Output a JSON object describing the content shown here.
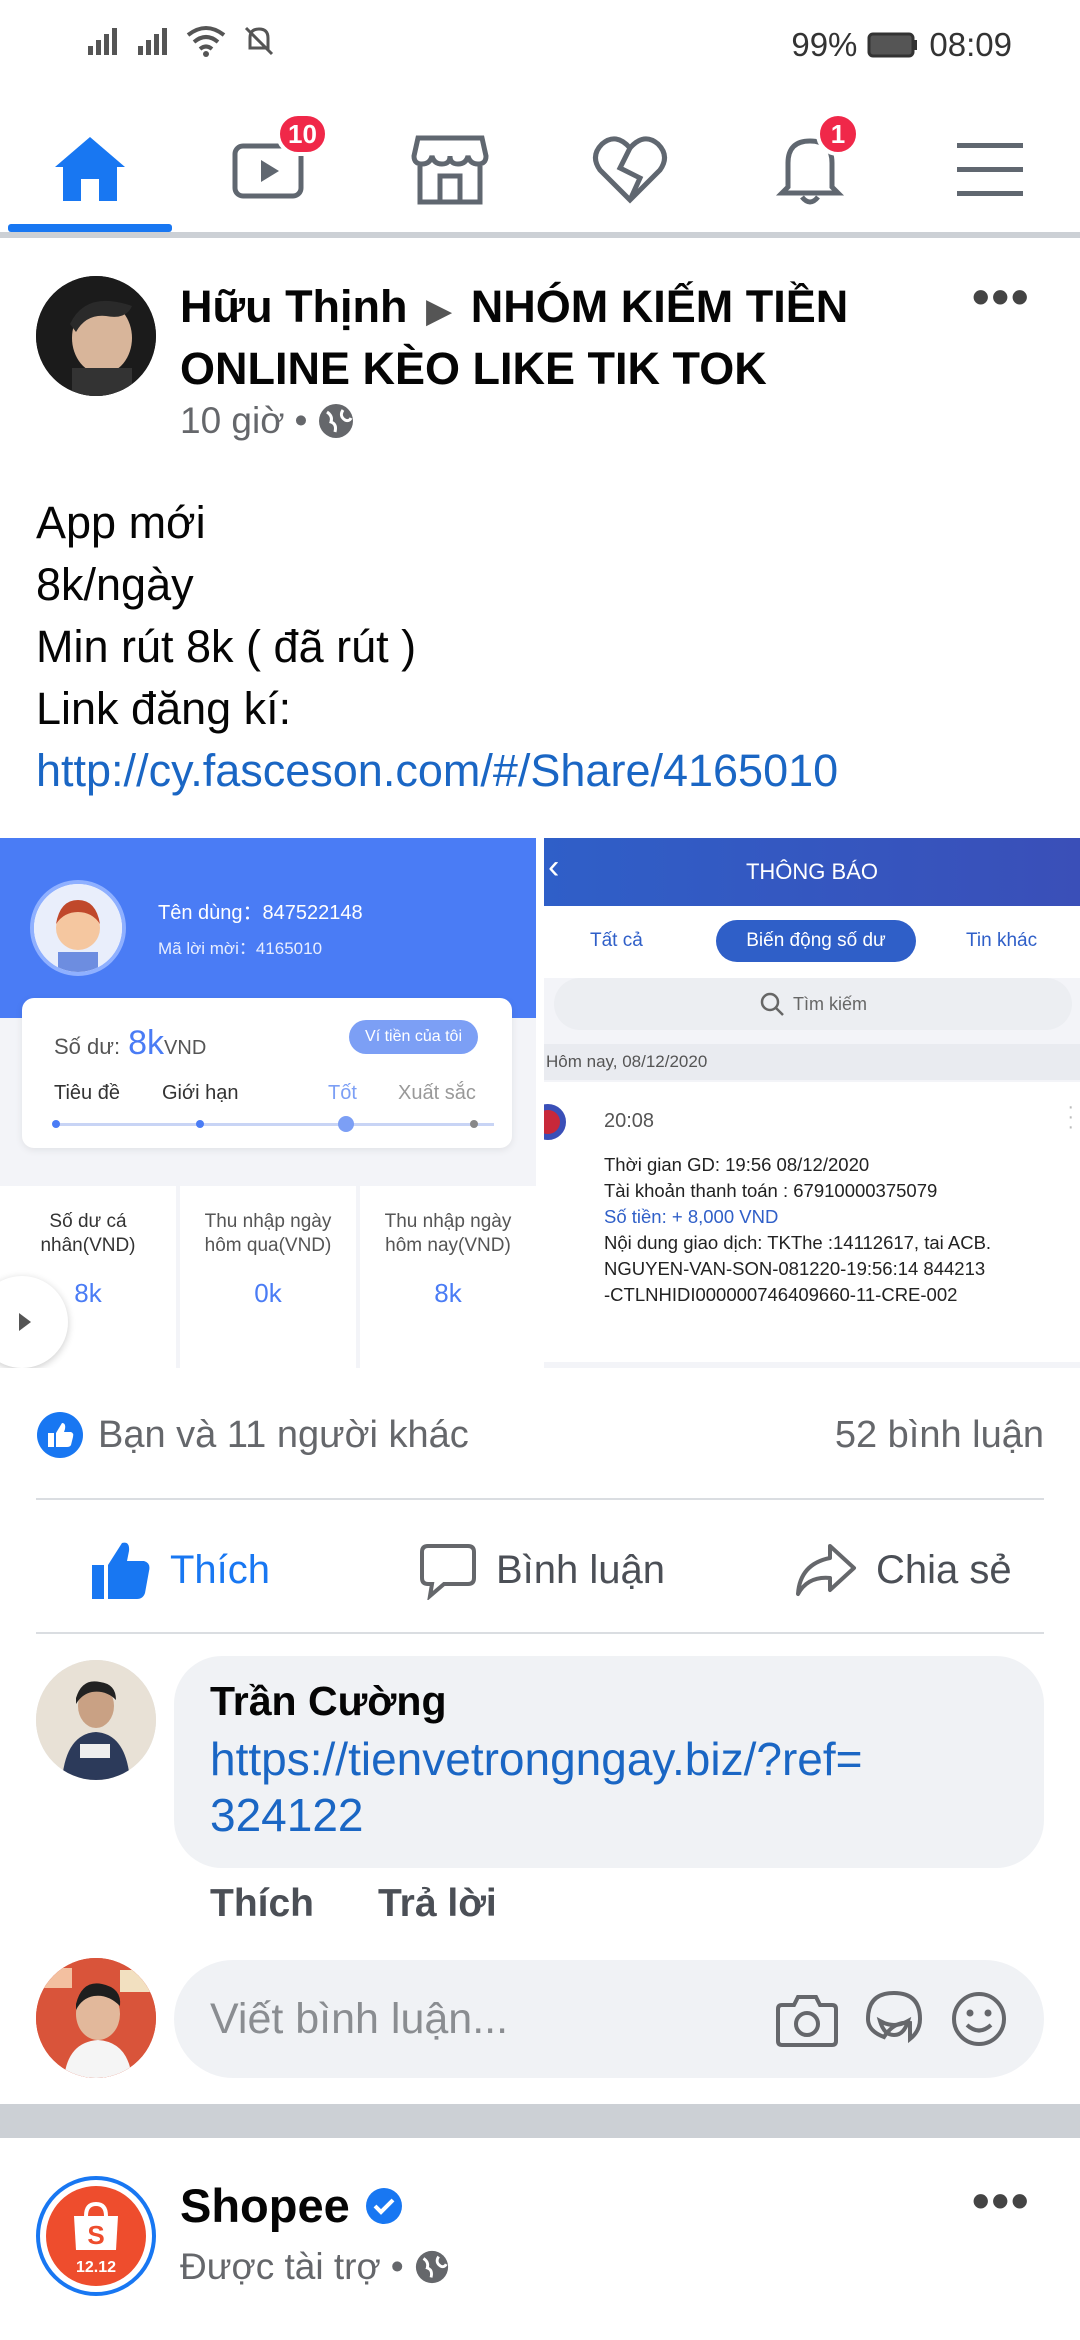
{
  "status_bar": {
    "battery": "99%",
    "time": "08:09"
  },
  "nav": {
    "watch_badge": "10",
    "notifications_badge": "1"
  },
  "post": {
    "author": "Hữu Thịnh",
    "group": "NHÓM KIẾM TIỀN ONLINE KÈO LIKE TIK TOK",
    "time": "10 giờ",
    "lines": [
      "App mới",
      "8k/ngày",
      "Min rút 8k ( đã rút )",
      "Link đăng kí:"
    ],
    "link": "http://cy.fasceson.com/#/Share/4165010"
  },
  "left_image": {
    "username_label": "Tên dùng：847522148",
    "invite_label": "Mã lời mời：4165010",
    "balance_label": "Số dư:",
    "balance_value": "8k",
    "balance_unit": "VND",
    "wallet_button": "Ví tiền của tôi",
    "levels": [
      "Tiêu đề",
      "Giới hạn",
      "Tốt",
      "Xuất sắc"
    ],
    "stats": [
      {
        "label": "Số dư cá nhân(VND)",
        "value": "8k"
      },
      {
        "label": "Thu nhập ngày hôm qua(VND)",
        "value": "0k"
      },
      {
        "label": "Thu nhập ngày hôm nay(VND)",
        "value": "8k"
      }
    ]
  },
  "right_image": {
    "title": "THÔNG BÁO",
    "tabs": [
      "Tất cả",
      "Biến động số dư",
      "Tin khác"
    ],
    "search_placeholder": "Tìm kiếm",
    "date_header": "Hôm nay, 08/12/2020",
    "time": "20:08",
    "lines": [
      "Thời gian GD: 19:56 08/12/2020",
      "Tài khoản thanh toán : 67910000375079",
      "Số tiền: + 8,000 VND",
      "Nội dung giao dịch: TKThe :14112617, tai ACB.",
      "NGUYEN-VAN-SON-081220-19:56:14 844213",
      "-CTLNHIDI000000746409660-11-CRE-002"
    ]
  },
  "reactions": {
    "likes_text": "Bạn và 11 người khác",
    "comments_text": "52 bình luận"
  },
  "actions": {
    "like": "Thích",
    "comment": "Bình luận",
    "share": "Chia sẻ"
  },
  "comment": {
    "name": "Trần Cường",
    "text_line1": "https://tienvetrongngay.biz/?ref=",
    "text_line2": "324122",
    "like": "Thích",
    "reply": "Trả lời"
  },
  "comment_input": {
    "placeholder": "Viết bình luận..."
  },
  "sponsored": {
    "name": "Shopee",
    "meta": "Được tài trợ",
    "logo_text": "12.12"
  },
  "colors": {
    "brand": "#1877f2",
    "badge": "#f02849"
  }
}
